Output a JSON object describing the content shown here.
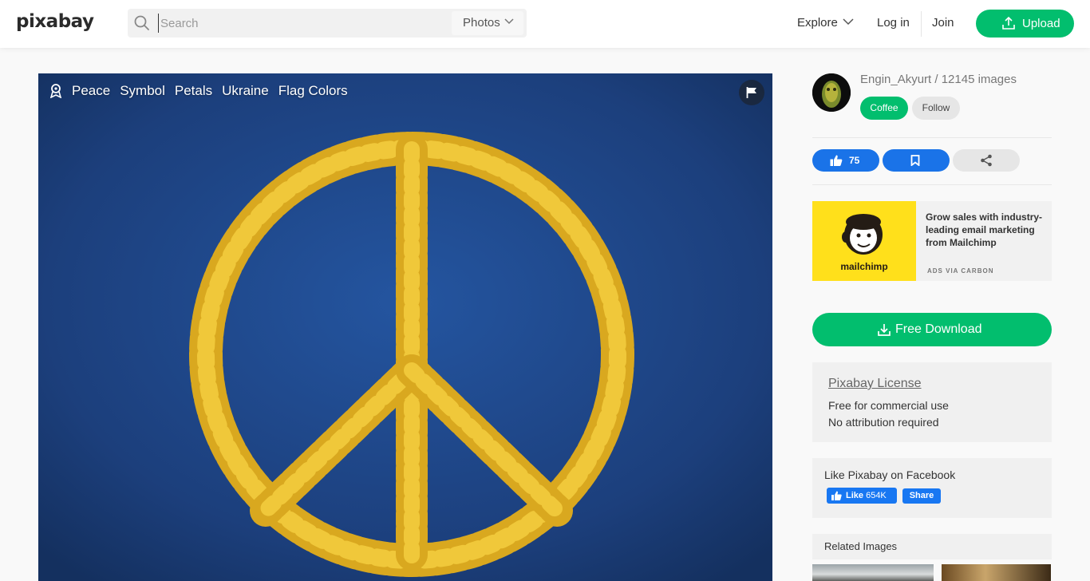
{
  "header": {
    "logo": "pixabay",
    "search_placeholder": "Search",
    "search_type": "Photos",
    "explore": "Explore",
    "login": "Log in",
    "join": "Join",
    "upload": "Upload"
  },
  "photo": {
    "tags": [
      "Peace",
      "Symbol",
      "Petals",
      "Ukraine",
      "Flag Colors"
    ]
  },
  "author": {
    "line": "Engin_Akyurt / 12145 images",
    "coffee": "Coffee",
    "follow": "Follow"
  },
  "actions": {
    "likes": "75"
  },
  "ad": {
    "brand": "mailchimp",
    "text": "Grow sales with industry-leading email marketing from Mailchimp",
    "via": "ADS VIA CARBON"
  },
  "download": {
    "label": "Free Download"
  },
  "license": {
    "title": "Pixabay License",
    "line1": "Free for commercial use",
    "line2": "No attribution required"
  },
  "facebook": {
    "title": "Like Pixabay on Facebook",
    "like_label": "Like",
    "like_count": "654K",
    "share": "Share"
  },
  "related": {
    "title": "Related Images"
  },
  "colors": {
    "brand_green": "#02be6e",
    "action_blue": "#1a73e8",
    "photo_bg": "#1d3f78",
    "petal_yellow": "#e8bd2a"
  }
}
